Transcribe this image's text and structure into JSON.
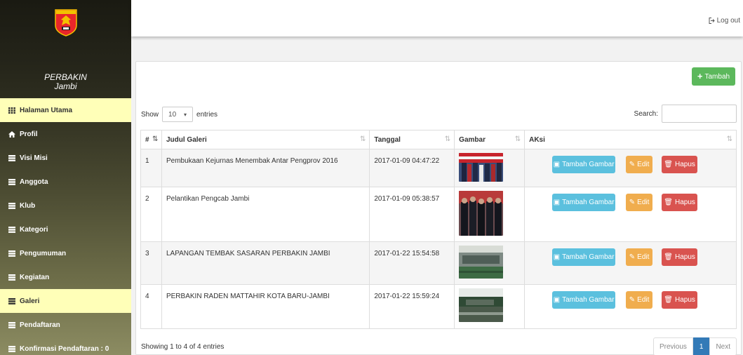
{
  "sidebar": {
    "logo_text": "PERBAKIN",
    "brand_line1": "PERBAKIN",
    "brand_line2": "Jambi",
    "items": [
      {
        "label": "Halaman Utama",
        "icon": "grid-icon",
        "active": true
      },
      {
        "label": "Profil",
        "icon": "home-icon",
        "active": false
      },
      {
        "label": "Visi Misi",
        "icon": "list-icon",
        "active": false
      },
      {
        "label": "Anggota",
        "icon": "list-icon",
        "active": false
      },
      {
        "label": "Klub",
        "icon": "list-icon",
        "active": false
      },
      {
        "label": "Kategori",
        "icon": "list-icon",
        "active": false
      },
      {
        "label": "Pengumuman",
        "icon": "list-icon",
        "active": false
      },
      {
        "label": "Kegiatan",
        "icon": "list-icon",
        "active": false
      },
      {
        "label": "Galeri",
        "icon": "list-icon",
        "active": true
      },
      {
        "label": "Pendaftaran",
        "icon": "list-icon",
        "active": false
      },
      {
        "label": "Konfirmasi Pendaftaran : 0",
        "icon": "list-icon",
        "active": false
      }
    ]
  },
  "topbar": {
    "logout_label": "Log out"
  },
  "panel": {
    "add_button": "Tambah",
    "show_label": "Show",
    "entries_value": "10",
    "entries_label": "entries",
    "search_label": "Search:",
    "search_value": ""
  },
  "table": {
    "headers": [
      "#",
      "Judul Galeri",
      "Tanggal",
      "Gambar",
      "AKsi"
    ],
    "rows": [
      {
        "no": "1",
        "title": "Pembukaan Kejurnas Menembak Antar Pengprov 2016",
        "date": "2017-01-09 04:47:22"
      },
      {
        "no": "2",
        "title": "Pelantikan Pengcab Jambi",
        "date": "2017-01-09 05:38:57"
      },
      {
        "no": "3",
        "title": "LAPANGAN TEMBAK SASARAN PERBAKIN JAMBI",
        "date": "2017-01-22 15:54:58"
      },
      {
        "no": "4",
        "title": "PERBAKIN RADEN MATTAHIR KOTA BARU-JAMBI",
        "date": "2017-01-22 15:59:24"
      }
    ],
    "actions": {
      "add_image": "Tambah Gambar",
      "edit": "Edit",
      "delete": "Hapus"
    }
  },
  "footer": {
    "info": "Showing 1 to 4 of 4 entries",
    "prev": "Previous",
    "page": "1",
    "next": "Next"
  },
  "colors": {
    "success": "#5cb85c",
    "info": "#5bc0de",
    "warning": "#f0ad4e",
    "danger": "#d9534f",
    "primary": "#337ab7",
    "active_nav": "#ffffb8"
  }
}
